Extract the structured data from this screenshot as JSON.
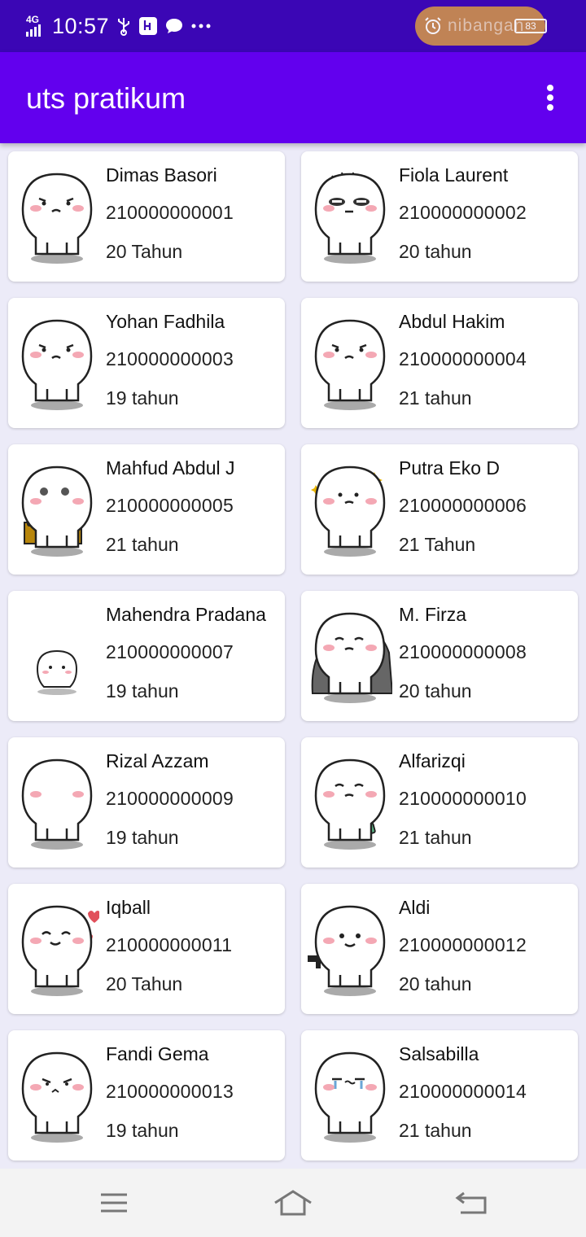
{
  "status_bar": {
    "network": "4G",
    "time": "10:57",
    "overlay_text": "nibangan",
    "battery": "83",
    "icons": [
      "signal-icon",
      "usb-icon",
      "usb-debug-icon",
      "chat-icon",
      "more-dots-icon",
      "alarm-icon",
      "vibrate-icon",
      "wifi-icon",
      "battery-icon"
    ]
  },
  "app_bar": {
    "title": "uts pratikum",
    "menu_icon": "overflow-menu-icon"
  },
  "students": [
    {
      "name": "Dimas Basori",
      "nim": "210000000001",
      "age": "20 Tahun",
      "avatar": "sad-blob"
    },
    {
      "name": "Fiola Laurent",
      "nim": "210000000002",
      "age": "20 tahun",
      "avatar": "grumpy-blob"
    },
    {
      "name": "Yohan Fadhila",
      "nim": "210000000003",
      "age": "19 tahun",
      "avatar": "sad-blob"
    },
    {
      "name": "Abdul Hakim",
      "nim": "210000000004",
      "age": "21 tahun",
      "avatar": "sad-blob"
    },
    {
      "name": "Mahfud Abdul J",
      "nim": "210000000005",
      "age": "21 tahun",
      "avatar": "laptop-blob"
    },
    {
      "name": "Putra Eko D",
      "nim": "210000000006",
      "age": "21 Tahun",
      "avatar": "thinking-blob"
    },
    {
      "name": "Mahendra Pradana",
      "nim": "210000000007",
      "age": "19 tahun",
      "avatar": "small-blob"
    },
    {
      "name": "M. Firza",
      "nim": "210000000008",
      "age": "20 tahun",
      "avatar": "blanket-blob"
    },
    {
      "name": "Rizal Azzam",
      "nim": "210000000009",
      "age": "19 tahun",
      "avatar": "shy-blob"
    },
    {
      "name": "Alfarizqi",
      "nim": "210000000010",
      "age": "21 tahun",
      "avatar": "phone-blob"
    },
    {
      "name": "Iqball",
      "nim": "210000000011",
      "age": "20 Tahun",
      "avatar": "love-blob"
    },
    {
      "name": "Aldi",
      "nim": "210000000012",
      "age": "20 tahun",
      "avatar": "gun-blob"
    },
    {
      "name": "Fandi Gema",
      "nim": "210000000013",
      "age": "19 tahun",
      "avatar": "angry-blob"
    },
    {
      "name": "Salsabilla",
      "nim": "210000000014",
      "age": "21 tahun",
      "avatar": "crying-blob"
    }
  ],
  "nav_bar": {
    "icons": [
      "menu-icon",
      "home-icon",
      "back-icon"
    ]
  },
  "colors": {
    "status_bar": "#3B06B5",
    "app_bar": "#6200EE",
    "background": "#ECEBF8",
    "card": "#FFFFFF",
    "blush": "#F4A8B4"
  }
}
